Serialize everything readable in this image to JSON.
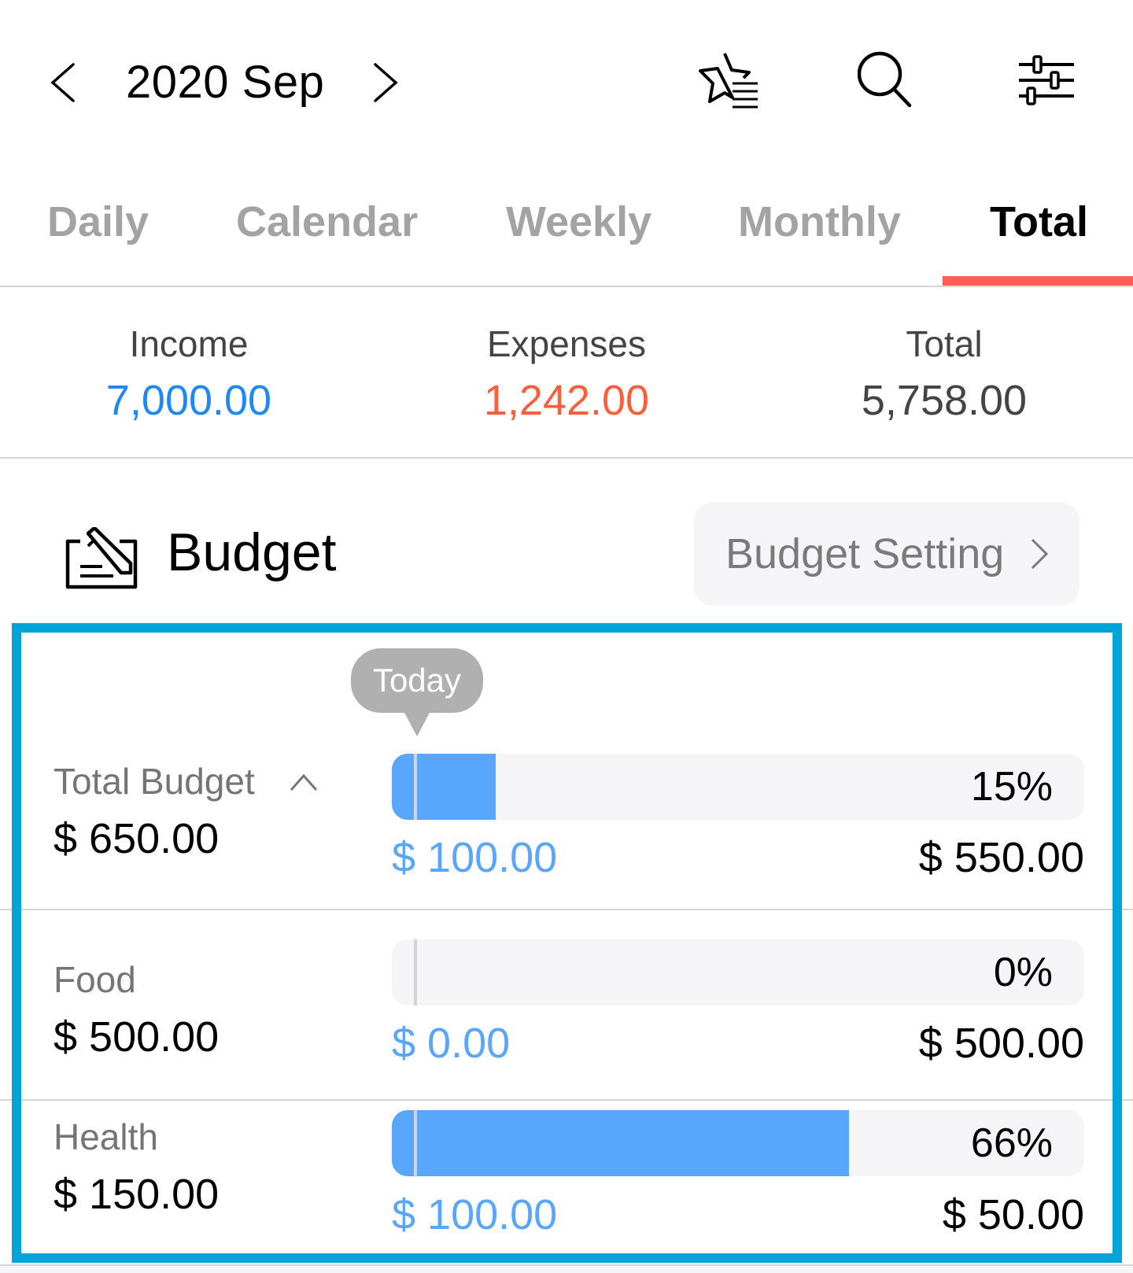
{
  "header": {
    "title": "2020 Sep",
    "prev_icon": "chevron-left-icon",
    "next_icon": "chevron-right-icon",
    "actions": [
      "bookmark-star-list-icon",
      "search-icon",
      "filter-sliders-icon"
    ]
  },
  "tabs": [
    {
      "label": "Daily",
      "active": false
    },
    {
      "label": "Calendar",
      "active": false
    },
    {
      "label": "Weekly",
      "active": false
    },
    {
      "label": "Monthly",
      "active": false
    },
    {
      "label": "Total",
      "active": true
    }
  ],
  "summary": {
    "income": {
      "label": "Income",
      "value": "7,000.00",
      "color": "#1e88f5"
    },
    "expenses": {
      "label": "Expenses",
      "value": "1,242.00",
      "color": "#fe5e3a"
    },
    "total": {
      "label": "Total",
      "value": "5,758.00",
      "color": "#444444"
    }
  },
  "budget": {
    "title": "Budget",
    "icon": "budget-pencil-icon",
    "setting_label": "Budget Setting",
    "today_label": "Today",
    "rows": [
      {
        "label": "Total Budget",
        "amount": "$ 650.00",
        "spent": "$ 100.00",
        "remaining": "$ 550.00",
        "percent_label": "15%",
        "percent": 15,
        "expanded": true
      },
      {
        "label": "Food",
        "amount": "$ 500.00",
        "spent": "$ 0.00",
        "remaining": "$ 500.00",
        "percent_label": "0%",
        "percent": 0
      },
      {
        "label": "Health",
        "amount": "$ 150.00",
        "spent": "$ 100.00",
        "remaining": "$ 50.00",
        "percent_label": "66%",
        "percent": 66
      }
    ]
  },
  "colors": {
    "accent_tab": "#fe5e54",
    "bar_fill": "#58a6fd",
    "bar_track": "#f5f5f7",
    "outline": "#00a4d9"
  }
}
